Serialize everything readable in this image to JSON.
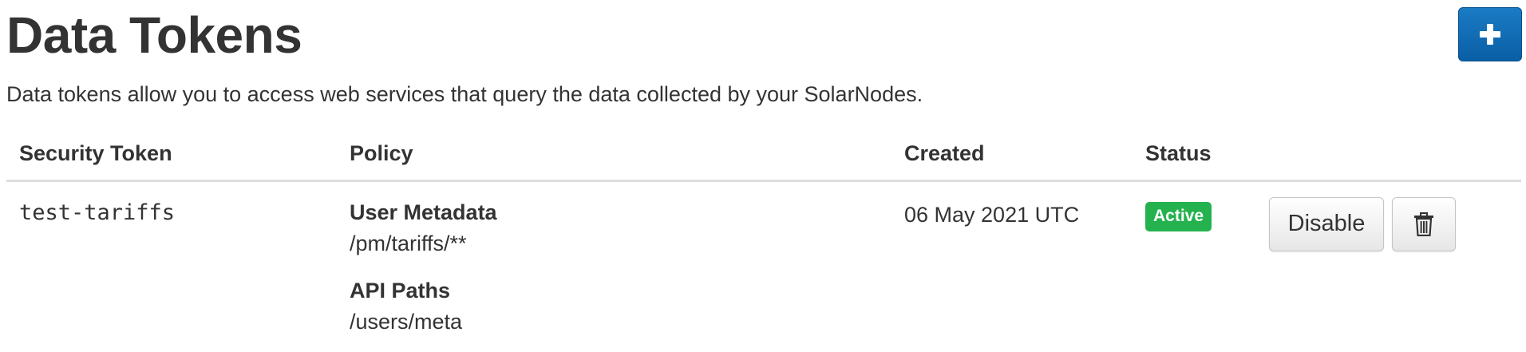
{
  "page": {
    "title": "Data Tokens",
    "intro": "Data tokens allow you to access web services that query the data collected by your SolarNodes.",
    "add_button_icon": "plus-icon"
  },
  "table": {
    "headers": {
      "token": "Security Token",
      "policy": "Policy",
      "created": "Created",
      "status": "Status"
    },
    "rows": [
      {
        "token": "test-tariffs",
        "policy": [
          {
            "heading": "User Metadata",
            "value": "/pm/tariffs/**"
          },
          {
            "heading": "API Paths",
            "value": "/users/meta"
          }
        ],
        "created": "06 May 2021 UTC",
        "status": "Active",
        "actions": {
          "disable_label": "Disable",
          "delete_icon": "trash-icon"
        }
      }
    ]
  },
  "colors": {
    "primary_button": "#0a5fa5",
    "status_active": "#24b24e",
    "text": "#333333",
    "divider": "#dddddd"
  }
}
